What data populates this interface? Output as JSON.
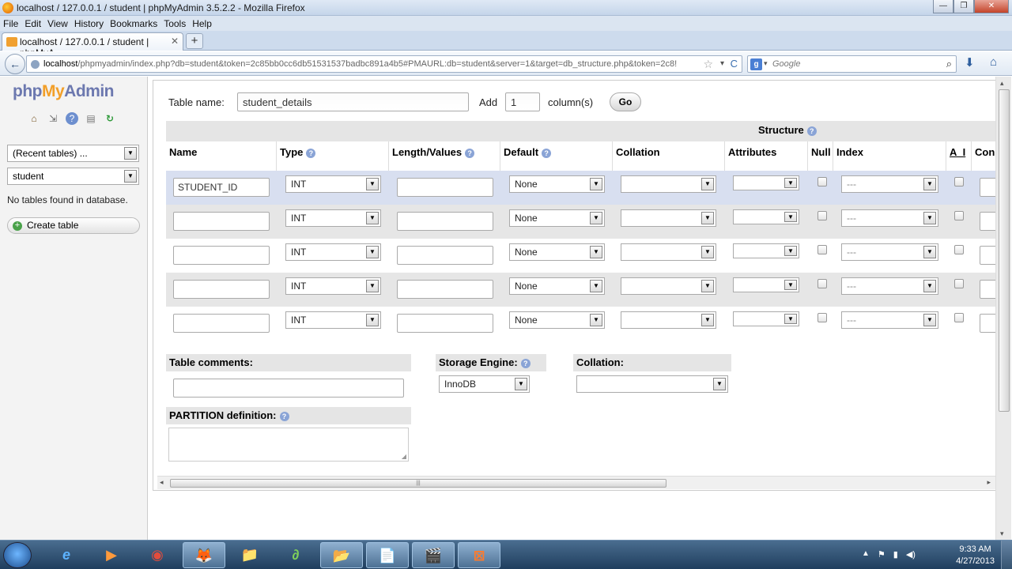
{
  "window": {
    "title": "localhost / 127.0.0.1 / student | phpMyAdmin 3.5.2.2 - Mozilla Firefox",
    "minimize": "—",
    "maximize": "❐",
    "close": "✕"
  },
  "menu": [
    "File",
    "Edit",
    "View",
    "History",
    "Bookmarks",
    "Tools",
    "Help"
  ],
  "tab": {
    "label": "localhost / 127.0.0.1 / student | phpMyA...",
    "close": "✕",
    "new_tab": "+"
  },
  "nav": {
    "back": "←",
    "url_host": "localhost",
    "url_rest": "/phpmyadmin/index.php?db=student&token=2c85bb0cc6db51531537badbc891a4b5#PMAURL:db=student&server=1&target=db_structure.php&token=2c8!",
    "star": "☆",
    "dropdown": "▾",
    "reload": "C",
    "search_engine": "g",
    "search_dropdown": "▾",
    "search_placeholder": "Google",
    "search_btn": "⌕",
    "download": "⬇",
    "home": "⌂"
  },
  "sidebar": {
    "logo_php": "php",
    "logo_my": "My",
    "logo_admin": "Admin",
    "icons": [
      "⌂",
      "⇲",
      "?",
      "▤",
      "↻"
    ],
    "recent_tables": "(Recent tables) ...",
    "database": "student",
    "no_tables": "No tables found in database.",
    "create_table": "Create table",
    "select_arrow": "▼"
  },
  "form": {
    "table_name_label": "Table name:",
    "table_name_value": "student_details",
    "add_label": "Add",
    "add_value": "1",
    "columns_label": "column(s)",
    "go_label": "Go",
    "structure_label": "Structure",
    "help_glyph": "?",
    "headers": [
      "Name",
      "Type",
      "Length/Values",
      "Default",
      "Collation",
      "Attributes",
      "Null",
      "Index",
      "A_I",
      "Con"
    ],
    "rows": [
      {
        "name": "STUDENT_ID",
        "type": "INT",
        "length": "",
        "default": "None",
        "collation": "",
        "attributes": "",
        "index": "---"
      },
      {
        "name": "",
        "type": "INT",
        "length": "",
        "default": "None",
        "collation": "",
        "attributes": "",
        "index": "---"
      },
      {
        "name": "",
        "type": "INT",
        "length": "",
        "default": "None",
        "collation": "",
        "attributes": "",
        "index": "---"
      },
      {
        "name": "",
        "type": "INT",
        "length": "",
        "default": "None",
        "collation": "",
        "attributes": "",
        "index": "---"
      },
      {
        "name": "",
        "type": "INT",
        "length": "",
        "default": "None",
        "collation": "",
        "attributes": "",
        "index": "---"
      }
    ],
    "table_comments_label": "Table comments:",
    "storage_engine_label": "Storage Engine:",
    "storage_engine_value": "InnoDB",
    "collation_label": "Collation:",
    "partition_label": "PARTITION definition:"
  },
  "scroll": {
    "left": "◂",
    "right": "▸",
    "up": "▴",
    "down": "▾",
    "grip": "|||"
  },
  "taskbar": {
    "items": [
      "e",
      "▶",
      "◉",
      "🦊",
      "📁",
      "∂",
      "📂",
      "📄",
      "🎬",
      "⊠"
    ],
    "tray": [
      "▲",
      "⚑",
      "▮",
      "◀)"
    ],
    "time": "9:33 AM",
    "date": "4/27/2013"
  }
}
